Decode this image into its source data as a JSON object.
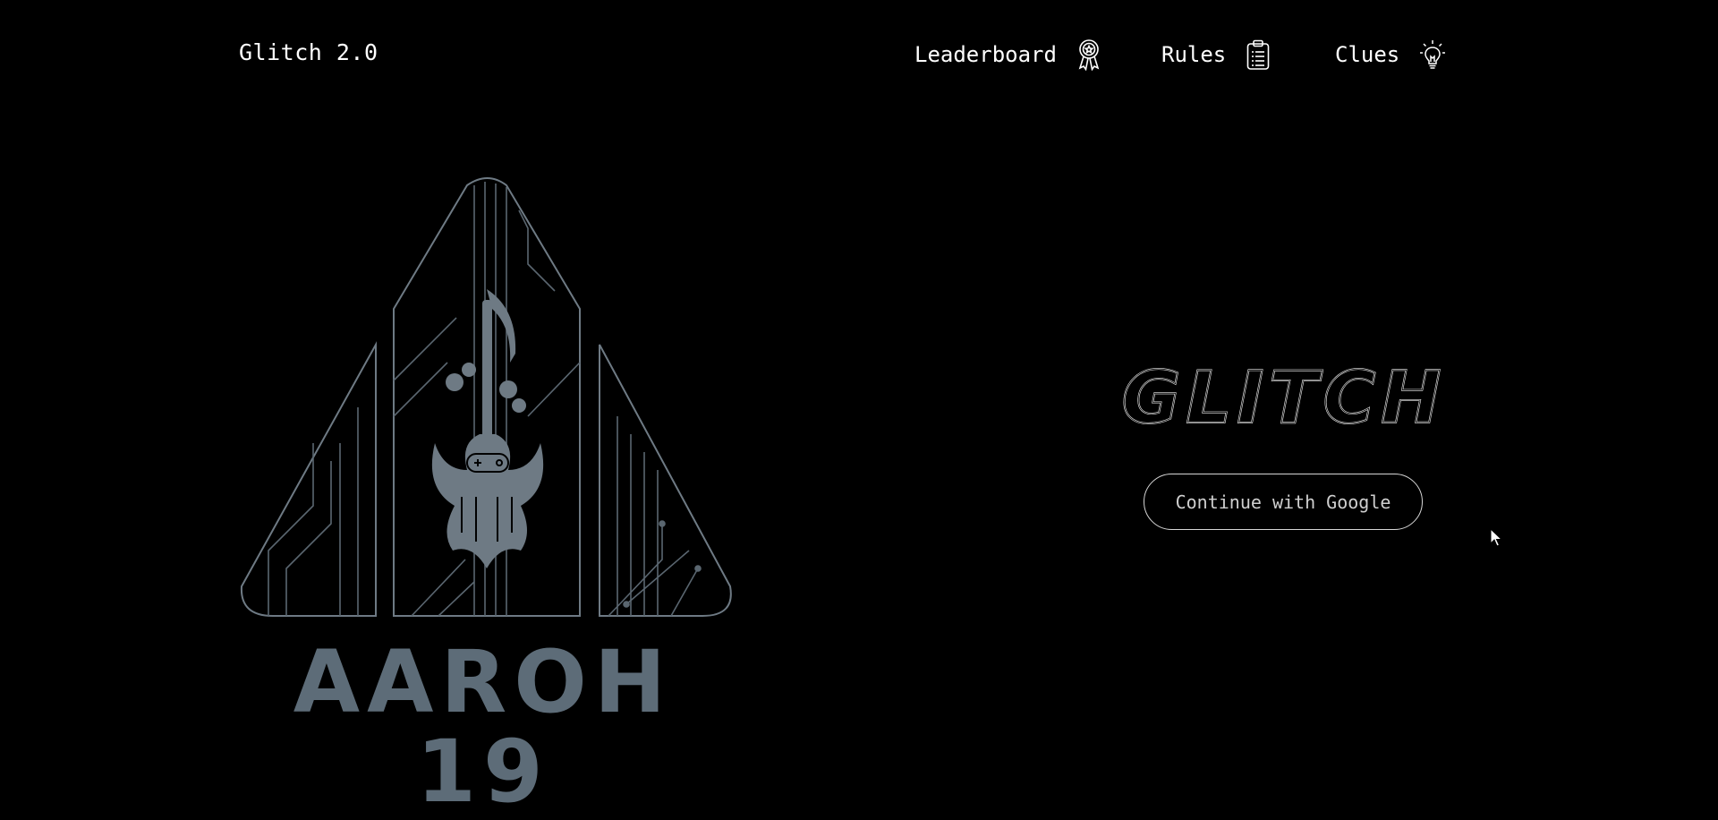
{
  "header": {
    "brand": "Glitch 2.0",
    "nav": [
      {
        "label": "Leaderboard",
        "icon": "award-ribbon-icon"
      },
      {
        "label": "Rules",
        "icon": "clipboard-list-icon"
      },
      {
        "label": "Clues",
        "icon": "lightbulb-icon"
      }
    ]
  },
  "hero": {
    "logo_text": "AAROH 19",
    "title": "GLITCH",
    "login_button": "Continue with Google"
  },
  "colors": {
    "background": "#000000",
    "logo_stroke": "#6e7a84",
    "logo_text": "#5d6c78",
    "title_outline": "#e6e6e6",
    "button_border": "#d6d6d6"
  }
}
